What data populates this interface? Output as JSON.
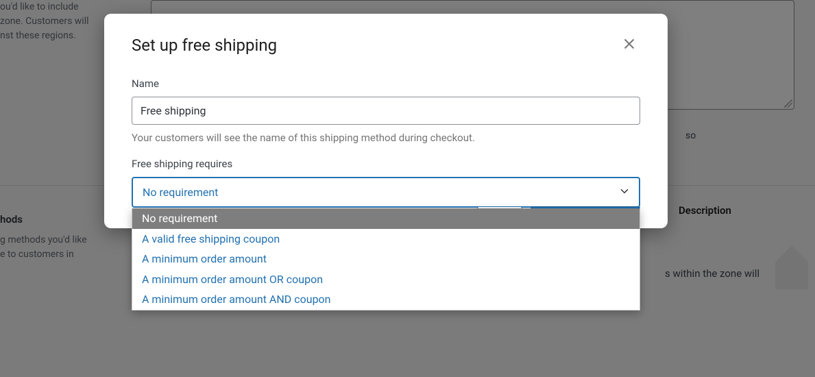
{
  "bg": {
    "regions_text1": "ou'd like to include",
    "regions_text2": "zone. Customers will",
    "regions_text3": "nst these regions.",
    "methods_heading": "hods",
    "methods_text1": "g methods you'd like",
    "methods_text2": "e to customers in",
    "so_fragment": "so",
    "desc_header": "Description",
    "zone_text": "s within the zone will"
  },
  "modal": {
    "title": "Set up free shipping",
    "name_label": "Name",
    "name_value": "Free shipping",
    "name_help": "Your customers will see the name of this shipping method during checkout.",
    "requires_label": "Free shipping requires",
    "requires_selected": "No requirement",
    "options": {
      "0": "No requirement",
      "1": "A valid free shipping coupon",
      "2": "A minimum order amount",
      "3": "A minimum order amount OR coupon",
      "4": "A minimum order amount AND coupon"
    }
  }
}
